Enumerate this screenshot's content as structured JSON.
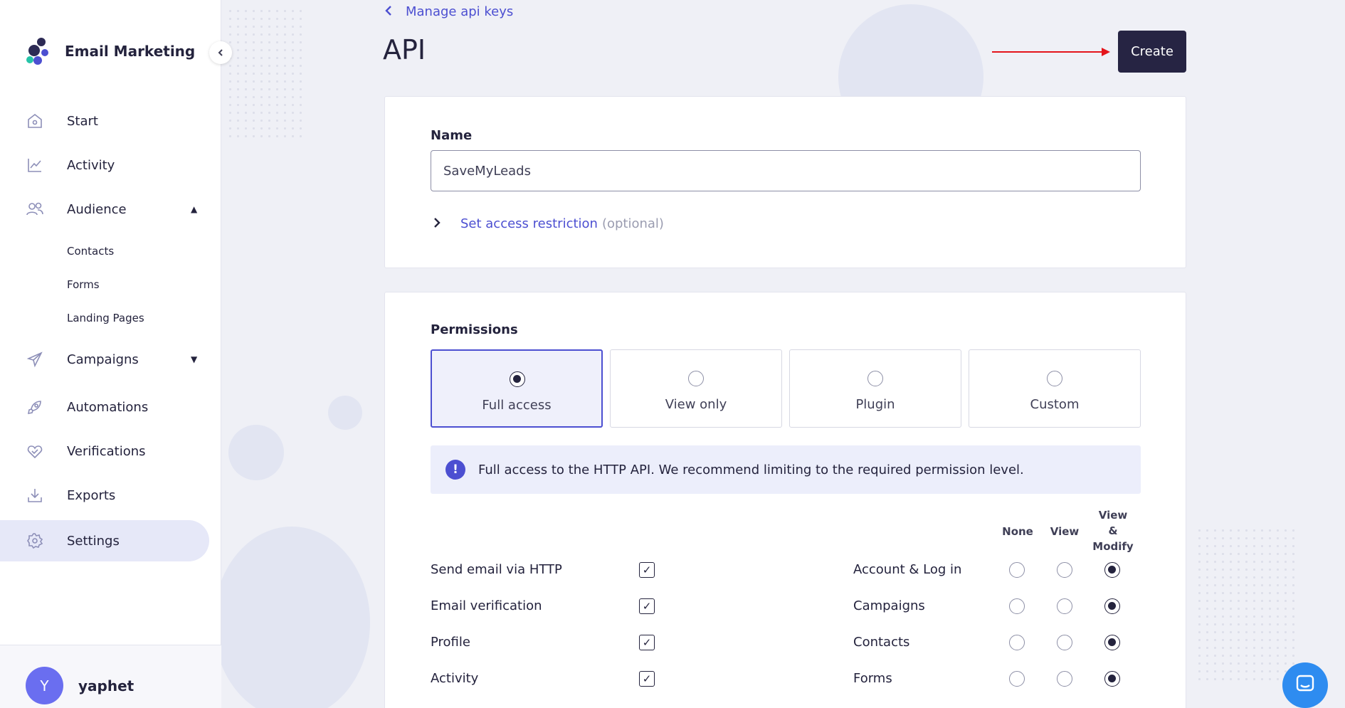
{
  "app": {
    "brand_title": "Email Marketing"
  },
  "sidebar": {
    "items": [
      {
        "label": "Start",
        "icon": "home-icon"
      },
      {
        "label": "Activity",
        "icon": "chart-icon"
      },
      {
        "label": "Audience",
        "icon": "users-icon",
        "expanded": true
      },
      {
        "label": "Campaigns",
        "icon": "paper-plane-icon",
        "expanded": false
      },
      {
        "label": "Automations",
        "icon": "rocket-icon"
      },
      {
        "label": "Verifications",
        "icon": "heart-check-icon"
      },
      {
        "label": "Exports",
        "icon": "download-icon"
      },
      {
        "label": "Settings",
        "icon": "gear-icon",
        "active": true
      }
    ],
    "audience_sub": [
      "Contacts",
      "Forms",
      "Landing Pages"
    ],
    "user": {
      "initial": "Y",
      "name": "yaphet"
    }
  },
  "header": {
    "back_label": "Manage api keys",
    "title": "API",
    "create_label": "Create"
  },
  "form": {
    "name_label": "Name",
    "name_value": "SaveMyLeads",
    "restriction_link": "Set access restriction",
    "restriction_optional": "(optional)"
  },
  "permissions": {
    "label": "Permissions",
    "options": [
      "Full access",
      "View only",
      "Plugin",
      "Custom"
    ],
    "selected": "Full access",
    "info_text": "Full access to the HTTP API. We recommend limiting to the required permission level.",
    "columns": [
      "None",
      "View",
      "View & Modify"
    ],
    "left_rows": [
      {
        "label": "Send email via HTTP",
        "checked": true
      },
      {
        "label": "Email verification",
        "checked": true
      },
      {
        "label": "Profile",
        "checked": true
      },
      {
        "label": "Activity",
        "checked": true
      }
    ],
    "right_rows": [
      {
        "label": "Account & Log in",
        "value": "View & Modify"
      },
      {
        "label": "Campaigns",
        "value": "View & Modify"
      },
      {
        "label": "Contacts",
        "value": "View & Modify"
      },
      {
        "label": "Forms",
        "value": "View & Modify"
      }
    ],
    "colors": {
      "accent": "#4c4fd1",
      "dark": "#262443"
    }
  }
}
